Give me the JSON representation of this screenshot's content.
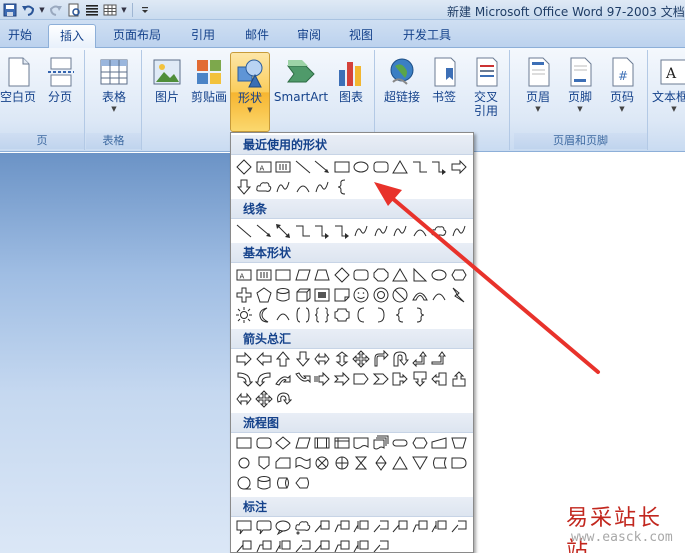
{
  "window": {
    "title": "新建 Microsoft Office Word 97-2003 文档"
  },
  "qat": {
    "icons": [
      "save-icon",
      "undo-icon",
      "redo-icon",
      "print-preview-icon",
      "align-icon",
      "table-icon",
      "customize-icon"
    ]
  },
  "tabs": [
    {
      "label": "开始",
      "active": false
    },
    {
      "label": "插入",
      "active": true
    },
    {
      "label": "页面布局",
      "active": false
    },
    {
      "label": "引用",
      "active": false
    },
    {
      "label": "邮件",
      "active": false
    },
    {
      "label": "审阅",
      "active": false
    },
    {
      "label": "视图",
      "active": false
    },
    {
      "label": "开发工具",
      "active": false
    }
  ],
  "ribbon": {
    "groups": {
      "pages": {
        "label": "页",
        "buttons": [
          "空白页",
          "分页"
        ]
      },
      "tables": {
        "label": "表格",
        "buttons": [
          "表格"
        ]
      },
      "illustrations": {
        "buttons": [
          "图片",
          "剪贴画",
          "形状",
          "SmartArt",
          "图表"
        ]
      },
      "links": {
        "buttons": [
          "超链接",
          "书签",
          "交叉\n引用"
        ]
      },
      "header_footer": {
        "label": "页眉和页脚",
        "buttons": [
          "页眉",
          "页脚",
          "页码"
        ]
      },
      "text": {
        "buttons": [
          "文本框"
        ]
      }
    }
  },
  "shapes_menu": {
    "sections": [
      {
        "title": "最近使用的形状"
      },
      {
        "title": "线条"
      },
      {
        "title": "基本形状"
      },
      {
        "title": "箭头总汇"
      },
      {
        "title": "流程图"
      },
      {
        "title": "标注"
      }
    ]
  },
  "watermark": {
    "text": "易采站长站",
    "url": "www.easck.com"
  },
  "colors": {
    "accent": "#15428b",
    "highlight": "#fbcd5b",
    "arrow": "#e8322b"
  }
}
